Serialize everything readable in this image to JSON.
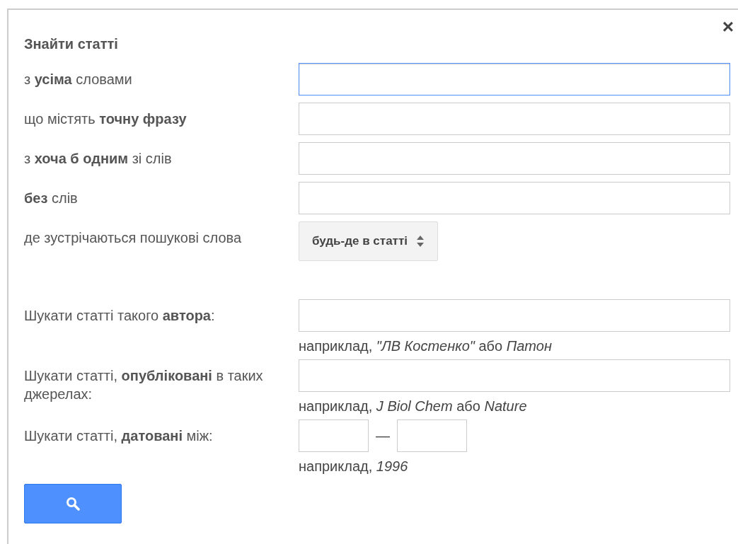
{
  "dialog": {
    "title": "Знайти статті",
    "close": "×"
  },
  "fields": [
    {
      "kind": "text",
      "label": "з **усіма** словами",
      "focused": true
    },
    {
      "kind": "text",
      "label": "що містять **точну фразу**",
      "focused": false
    },
    {
      "kind": "text",
      "label": "з **хоча б одним** зі слів",
      "focused": false
    },
    {
      "kind": "text",
      "label": "**без** слів",
      "focused": false
    },
    {
      "kind": "select",
      "label": "де зустрічаються пошукові слова",
      "value": "будь-де в статті"
    },
    {
      "kind": "text",
      "label": "Шукати статті такого **автора**:",
      "focused": false,
      "hint": "наприклад, *\"ЛВ Костенко\"* або *Патон*"
    },
    {
      "kind": "text",
      "label": "Шукати статті, **опубліковані** в таких джерелах:",
      "focused": false,
      "hint": "наприклад, *J Biol Chem* або *Nature*"
    },
    {
      "kind": "range",
      "label": "Шукати статті, **датовані** між:",
      "separator": "—",
      "hint": "наприклад, *1996*"
    }
  ],
  "search_button": {
    "kind": "search"
  }
}
